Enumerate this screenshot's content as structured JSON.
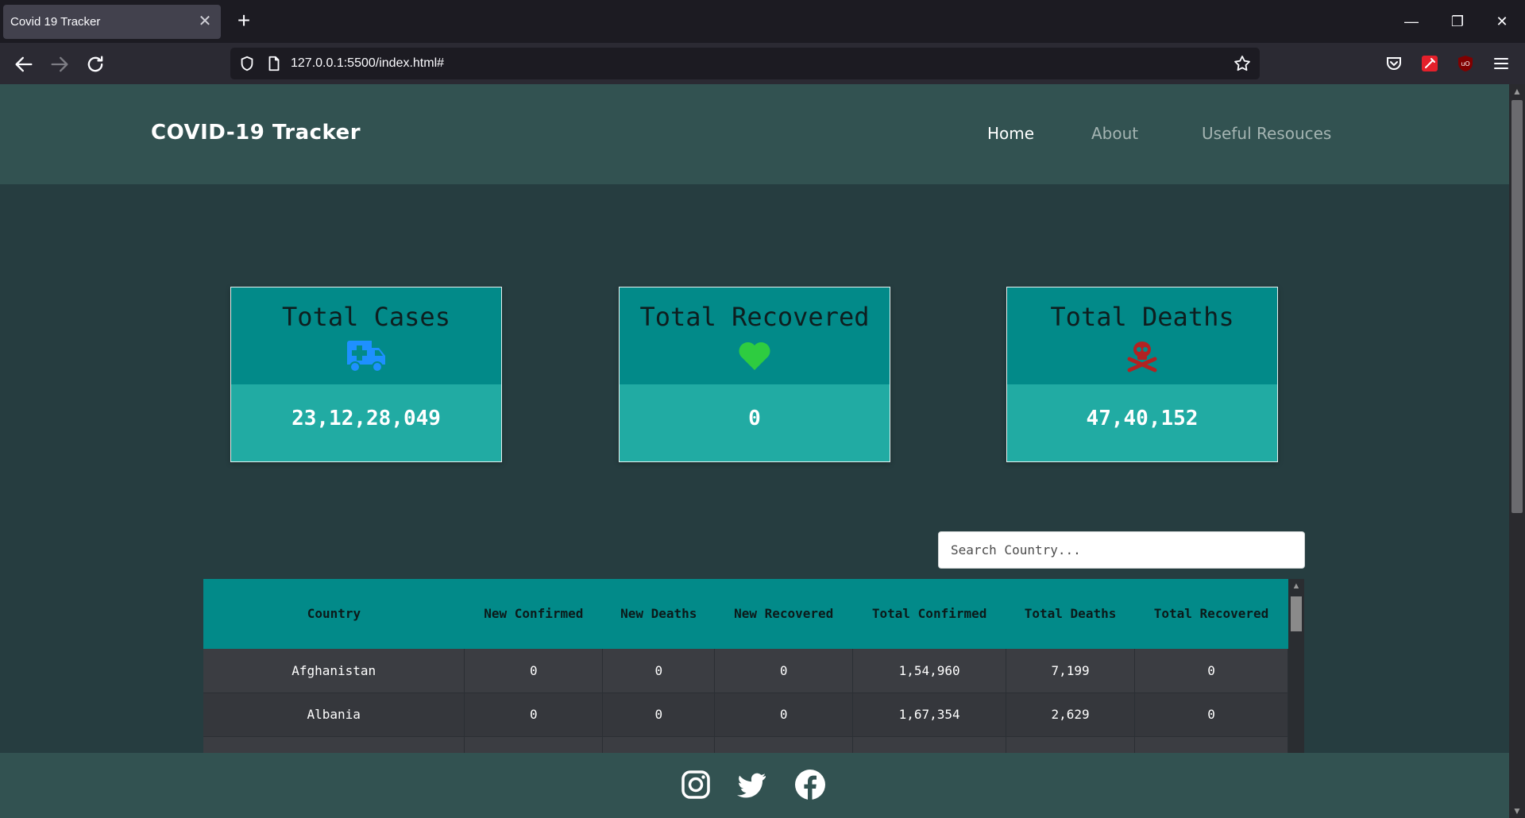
{
  "browser": {
    "tab_title": "Covid 19 Tracker",
    "url": "127.0.0.1:5500/index.html#"
  },
  "site": {
    "logo": "COVID-19 Tracker",
    "nav": [
      {
        "label": "Home",
        "active": true
      },
      {
        "label": "About",
        "active": false
      },
      {
        "label": "Useful Resouces",
        "active": false
      }
    ]
  },
  "stats": [
    {
      "title": "Total Cases",
      "icon": "ambulance-icon",
      "icon_color": "#1e90ff",
      "value": "23,12,28,049"
    },
    {
      "title": "Total Recovered",
      "icon": "heart-icon",
      "icon_color": "#2ecc40",
      "value": "0"
    },
    {
      "title": "Total Deaths",
      "icon": "skull-crossbones-icon",
      "icon_color": "#b22222",
      "value": "47,40,152"
    }
  ],
  "search": {
    "placeholder": "Search Country..."
  },
  "table": {
    "headers": [
      "Country",
      "New Confirmed",
      "New Deaths",
      "New Recovered",
      "Total Confirmed",
      "Total Deaths",
      "Total Recovered"
    ],
    "rows": [
      [
        "Afghanistan",
        "0",
        "0",
        "0",
        "1,54,960",
        "7,199",
        "0"
      ],
      [
        "Albania",
        "0",
        "0",
        "0",
        "1,67,354",
        "2,629",
        "0"
      ]
    ]
  },
  "footer": {
    "social": [
      "instagram-icon",
      "twitter-icon",
      "facebook-icon"
    ]
  }
}
